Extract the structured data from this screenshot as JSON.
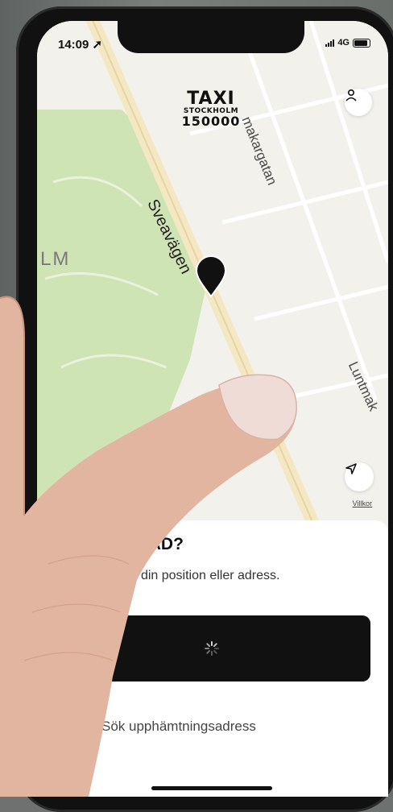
{
  "status_bar": {
    "time": "14:09",
    "network": "4G"
  },
  "logo": {
    "line1": "TAXI",
    "line2": "STOCKHOLM",
    "line3": "150000"
  },
  "map": {
    "district_label": "LM",
    "streets": {
      "sveavagen": "Sveavägen",
      "malmakargatan": "makargatan",
      "luntmakargatan": "Luntmak"
    },
    "terms_link": "Villkor"
  },
  "sheet": {
    "title": "BLI HÄMTAD?",
    "description": "rslaget nära din position eller adress.",
    "search_label": "Sök upphämtningsadress"
  },
  "colors": {
    "map_bg": "#f2f1ec",
    "park": "#cfe4b4",
    "road": "#f4e7c3",
    "button": "#111111"
  },
  "icons": {
    "profile": "person-icon",
    "location": "navigation-arrow-icon",
    "pin": "map-pin-icon",
    "spinner": "loading-spinner-icon"
  }
}
